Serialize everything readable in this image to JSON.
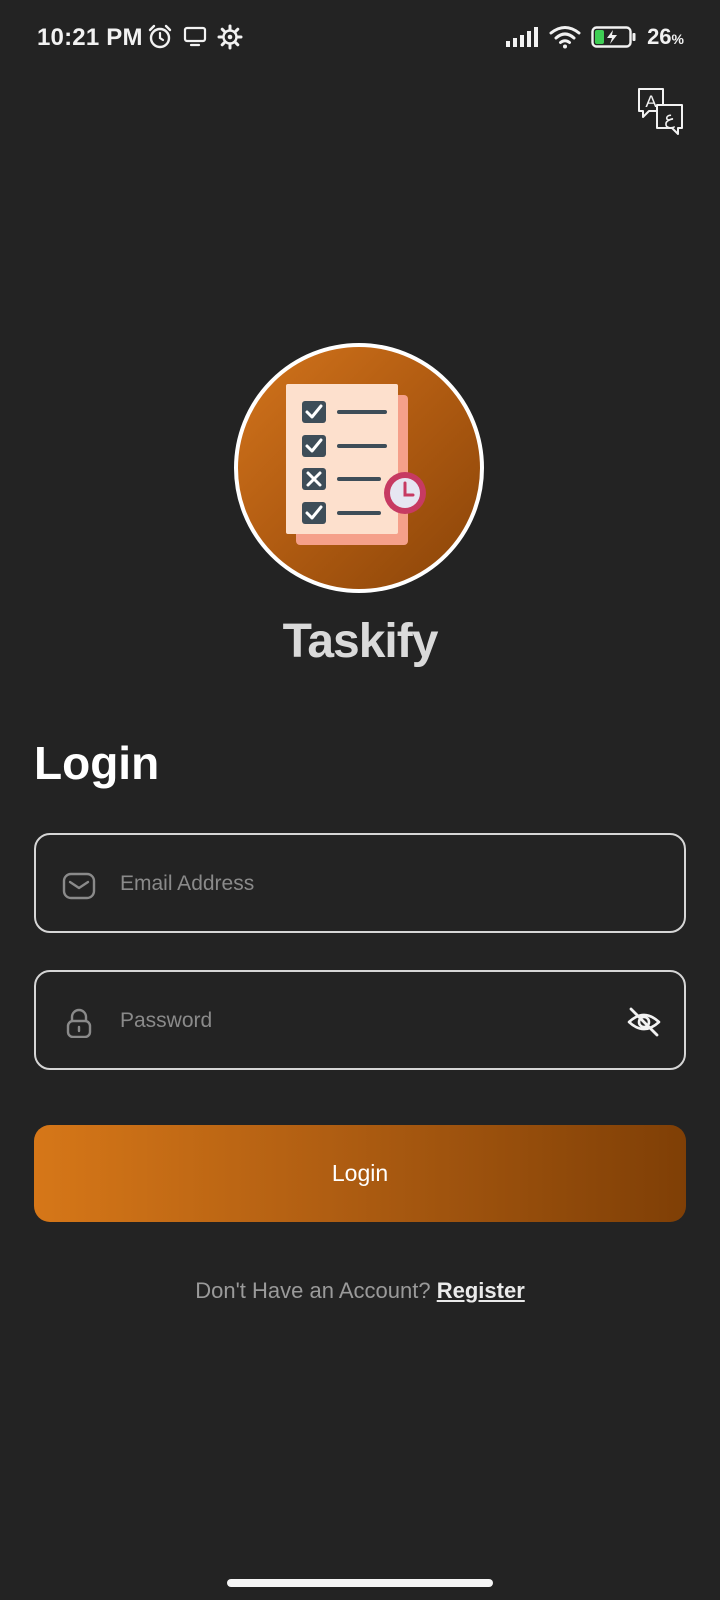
{
  "status_bar": {
    "time": "10:21 PM",
    "battery_percent": "26",
    "battery_unit": "%",
    "icons": [
      "alarm-icon",
      "screen-cast-icon",
      "settings-gear-icon",
      "signal-icon",
      "wifi-icon",
      "battery-charging-icon"
    ]
  },
  "header": {
    "translate_icon": "translate-icon"
  },
  "brand": {
    "app_name": "Taskify",
    "logo_icon": "checklist-clock-logo"
  },
  "form": {
    "heading": "Login",
    "email": {
      "placeholder": "Email Address",
      "value": "",
      "icon": "mail-icon"
    },
    "password": {
      "placeholder": "Password",
      "value": "",
      "icon": "lock-icon",
      "toggle_icon": "eye-off-icon"
    },
    "submit_label": "Login"
  },
  "footer": {
    "prompt": "Don't Have an Account?",
    "register_label": "Register"
  },
  "colors": {
    "background": "#232323",
    "accent_start": "#d67718",
    "accent_end": "#7f3f06",
    "field_border": "#d6d6d6"
  }
}
